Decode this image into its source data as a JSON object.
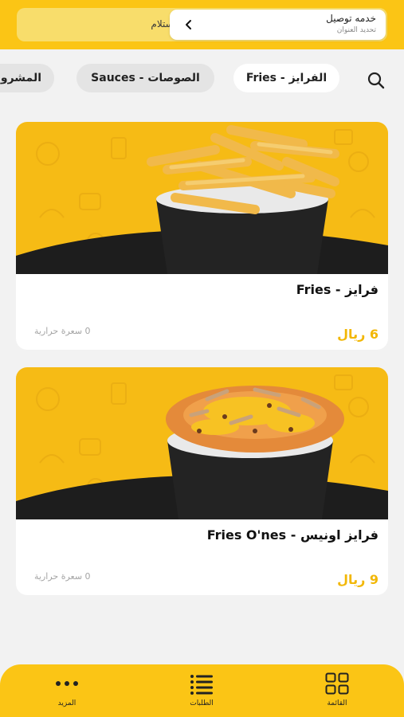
{
  "header": {
    "delivery_title": "خدمه توصيل",
    "delivery_subtitle": "تحديد العنوان",
    "pickup_label": "استلام"
  },
  "categories": [
    {
      "label": "الفرايز - Fries",
      "active": true
    },
    {
      "label": "الصوصات - Sauces",
      "active": false
    },
    {
      "label": "المشروبات",
      "active": false
    }
  ],
  "products": [
    {
      "name": "فرايز - Fries",
      "price": "6 ريال",
      "calories": "0 سعرة حرارية",
      "image": "fries-bowl"
    },
    {
      "name": "فرايز اونيس - Fries O'nes",
      "price": "9 ريال",
      "calories": "0 سعرة حرارية",
      "image": "loaded-fries-bowl"
    }
  ],
  "bottom_nav": [
    {
      "label": "القائمة",
      "icon": "grid-icon"
    },
    {
      "label": "الطلبات",
      "icon": "list-icon"
    },
    {
      "label": "المزيد",
      "icon": "more-icon"
    }
  ],
  "colors": {
    "brand_yellow": "#fbc515",
    "price_yellow": "#f2b705",
    "background": "#f2f2f2"
  }
}
